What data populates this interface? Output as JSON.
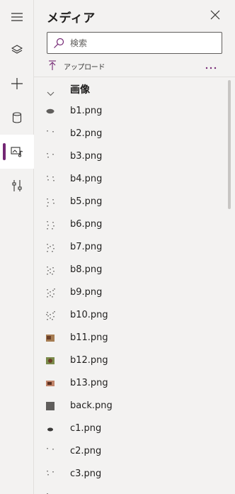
{
  "rail": {
    "items": [
      {
        "id": "menu",
        "icon": "hamburger-icon"
      },
      {
        "id": "layers",
        "icon": "layers-icon"
      },
      {
        "id": "insert",
        "icon": "plus-icon"
      },
      {
        "id": "data",
        "icon": "database-icon"
      },
      {
        "id": "media",
        "icon": "media-icon",
        "active": true
      },
      {
        "id": "tools",
        "icon": "tools-icon"
      }
    ],
    "accent": "#742774"
  },
  "panel": {
    "title": "メディア",
    "close_icon": "close-icon"
  },
  "search": {
    "placeholder": "検索",
    "value": ""
  },
  "toolbar": {
    "upload_label": "アップロード",
    "more_icon": "more-icon"
  },
  "group": {
    "title": "画像",
    "expanded": true
  },
  "files": [
    {
      "name": "b1.png",
      "thumb": "blob"
    },
    {
      "name": "b2.png",
      "thumb": "dots2"
    },
    {
      "name": "b3.png",
      "thumb": "dots3"
    },
    {
      "name": "b4.png",
      "thumb": "dots4"
    },
    {
      "name": "b5.png",
      "thumb": "dots5"
    },
    {
      "name": "b6.png",
      "thumb": "dots6"
    },
    {
      "name": "b7.png",
      "thumb": "dots7"
    },
    {
      "name": "b8.png",
      "thumb": "dots8"
    },
    {
      "name": "b9.png",
      "thumb": "dots9"
    },
    {
      "name": "b10.png",
      "thumb": "dots10"
    },
    {
      "name": "b11.png",
      "thumb": "photo"
    },
    {
      "name": "b12.png",
      "thumb": "photo2"
    },
    {
      "name": "b13.png",
      "thumb": "photo3"
    },
    {
      "name": "back.png",
      "thumb": "dark"
    },
    {
      "name": "c1.png",
      "thumb": "blob2"
    },
    {
      "name": "c2.png",
      "thumb": "dots2"
    },
    {
      "name": "c3.png",
      "thumb": "dots3"
    },
    {
      "name": "",
      "thumb": "partial"
    }
  ]
}
